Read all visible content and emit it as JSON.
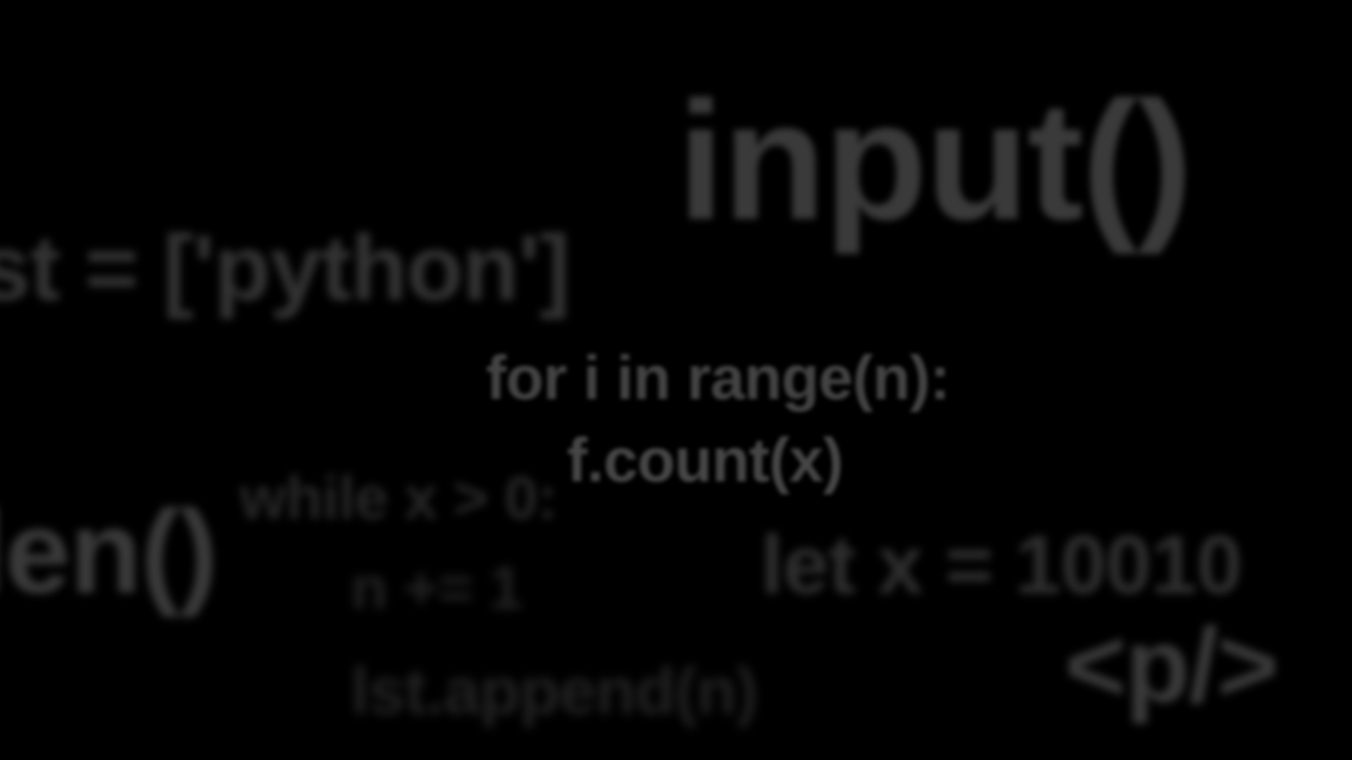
{
  "background_color": "#000000",
  "fragments": {
    "input": "input()",
    "lst": "st = ['python']",
    "for_loop": "for i in range(n):",
    "count": "f.count(x)",
    "while_loop": "while x > 0:",
    "len": "len()",
    "increment": "n += 1",
    "let_x": "let x = 10010",
    "p_tag": "<p/>",
    "append": "lst.append(n)"
  }
}
